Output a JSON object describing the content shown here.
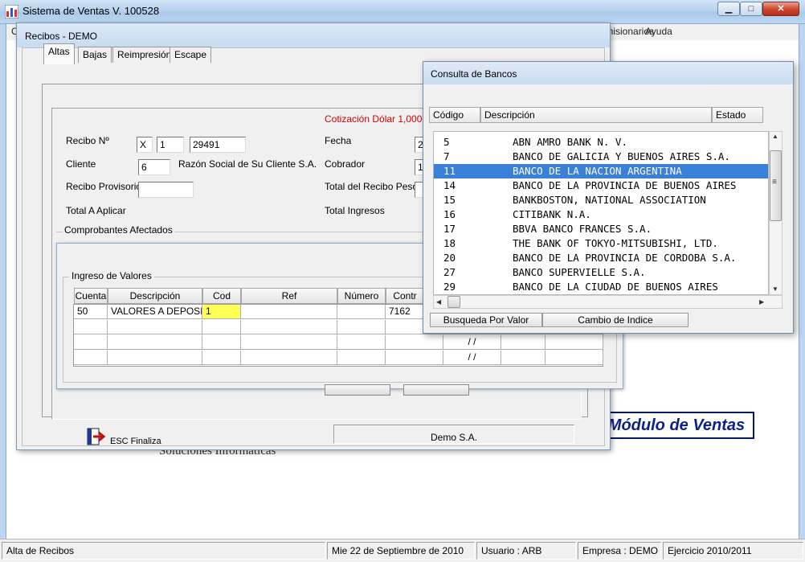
{
  "main_window": {
    "title": "Sistema de Ventas V. 100528",
    "minimize_glyph": "▁",
    "maximize_glyph": "□",
    "close_glyph": "✕"
  },
  "menu": {
    "items": [
      "C",
      "Comisionarios",
      "Ayuda"
    ]
  },
  "module_label": "Módulo de Ventas",
  "company_tagline": "Soluciones Informáticas",
  "recibos": {
    "title": "Recibos   - DEMO",
    "tabs": [
      "Altas",
      "Bajas",
      "Reimpresión",
      "Escape"
    ],
    "cotizacion": "Cotización Dólar   1,0000",
    "recibo_label": "Recibo Nº",
    "recibo_tipo": "X",
    "recibo_suc": "1",
    "recibo_numero": "29491",
    "cliente_label": "Cliente",
    "cliente_codigo": "6",
    "cliente_nombre": "Razón Social de Su Cliente S.A.",
    "provisorio_label": "Recibo Provisorio",
    "total_aplicar_label": "Total A Aplicar",
    "fecha_label": "Fecha",
    "fecha_value": "2",
    "cobrador_label": "Cobrador",
    "cobrador_value": "1",
    "total_pesos_label": "Total del Recibo Pesos",
    "total_ingresos_label": "Total Ingresos",
    "comprobantes_label": "Comprobantes Afectados",
    "esc_label": "ESC Finaliza",
    "footer_company": "Demo S.A."
  },
  "valores": {
    "group_title": "Ingreso de Valores",
    "columns": [
      "Cuenta",
      "Descripción",
      "Cod",
      "Ref",
      "Número",
      "Contr"
    ],
    "rows": [
      {
        "cuenta": "50",
        "descripcion": "VALORES A DEPOSITAR",
        "cod": "1",
        "ref": "",
        "numero": "",
        "contr": "7162",
        "fecha": ""
      },
      {
        "cuenta": "",
        "descripcion": "",
        "cod": "",
        "ref": "",
        "numero": "",
        "contr": "",
        "fecha": "/    /"
      },
      {
        "cuenta": "",
        "descripcion": "",
        "cod": "",
        "ref": "",
        "numero": "",
        "contr": "",
        "fecha": "/    /"
      },
      {
        "cuenta": "",
        "descripcion": "",
        "cod": "",
        "ref": "",
        "numero": "",
        "contr": "",
        "fecha": "/    /"
      }
    ]
  },
  "bancos": {
    "title": "Consulta de Bancos",
    "columns": [
      "Código",
      "Descripción",
      "Estado"
    ],
    "rows": [
      {
        "codigo": "5",
        "descripcion": "ABN AMRO BANK N. V."
      },
      {
        "codigo": "7",
        "descripcion": "BANCO DE GALICIA Y BUENOS AIRES S.A."
      },
      {
        "codigo": "11",
        "descripcion": "BANCO DE LA NACION ARGENTINA"
      },
      {
        "codigo": "14",
        "descripcion": "BANCO DE LA PROVINCIA DE BUENOS AIRES"
      },
      {
        "codigo": "15",
        "descripcion": "BANKBOSTON, NATIONAL ASSOCIATION"
      },
      {
        "codigo": "16",
        "descripcion": "CITIBANK N.A."
      },
      {
        "codigo": "17",
        "descripcion": "BBVA BANCO FRANCES S.A."
      },
      {
        "codigo": "18",
        "descripcion": "THE BANK OF TOKYO-MITSUBISHI, LTD."
      },
      {
        "codigo": "20",
        "descripcion": "BANCO DE LA PROVINCIA DE CORDOBA S.A."
      },
      {
        "codigo": "27",
        "descripcion": "BANCO SUPERVIELLE S.A."
      },
      {
        "codigo": "29",
        "descripcion": "BANCO DE LA CIUDAD DE BUENOS AIRES"
      }
    ],
    "selected_index": 2,
    "btn_busqueda": "Busqueda Por Valor",
    "btn_indice": "Cambio de Indice",
    "scroll_up": "▲",
    "scroll_down": "▼",
    "scroll_left": "◀",
    "scroll_right": "▶",
    "grip": "≡"
  },
  "status": {
    "screen": "Alta de Recibos",
    "fecha": "Mie 22 de Septiembre de 2010",
    "usuario": "Usuario : ARB",
    "empresa": "Empresa : DEMO",
    "ejercicio": "Ejercicio 2010/2011"
  },
  "colors": {
    "selection": "#3a7fd8",
    "cotizacion": "#d00000",
    "module_text": "#0a1f8f",
    "edit_cell": "#ffff55"
  }
}
